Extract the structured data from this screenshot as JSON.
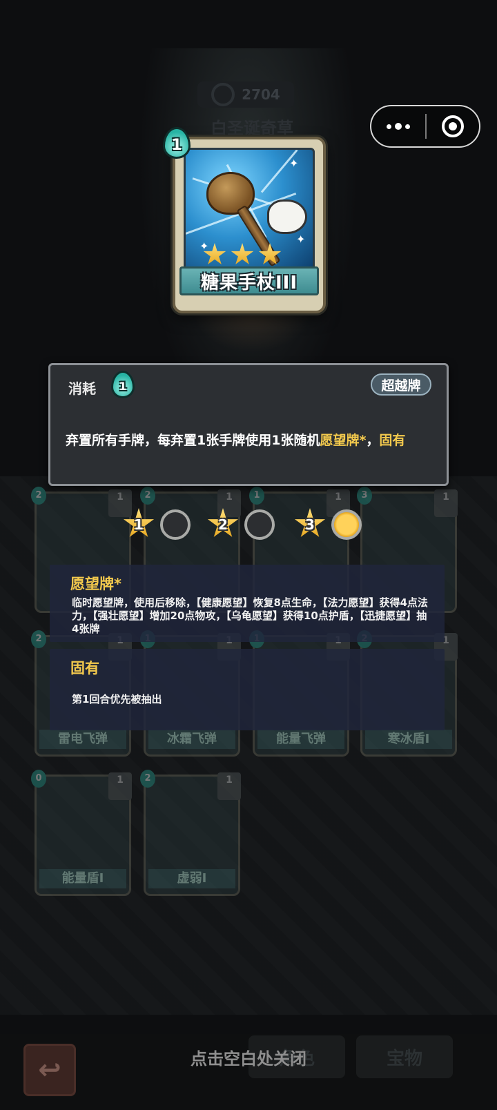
{
  "background": {
    "coin_value": "2704",
    "scene_title": "白圣诞奇草"
  },
  "capsule": {
    "more_icon": "more-dots-icon",
    "close_icon": "target-circle-icon"
  },
  "featured_card": {
    "cost": "1",
    "name": "糖果手杖III",
    "stars": 3
  },
  "info_panel": {
    "cost_label": "消耗",
    "cost_value": "1",
    "badge": "超越牌",
    "description_prefix": "弃置所有手牌，每弃置1张手牌使用1张随机",
    "description_keyword_1": "愿望牌*",
    "description_sep": "，",
    "description_keyword_2": "固有"
  },
  "tier_selector": {
    "tiers": [
      "1",
      "2",
      "3"
    ],
    "selected": "3"
  },
  "tooltips": [
    {
      "title": "愿望牌*",
      "body": "临时愿望牌，使用后移除，【健康愿望】恢复8点生命，【法力愿望】获得4点法力，【强壮愿望】增加20点物攻，【乌龟愿望】获得10点护盾，【迅捷愿望】抽4张牌"
    },
    {
      "title": "固有",
      "body": "第1回合优先被抽出"
    }
  ],
  "deck_cards": [
    {
      "cost": "2",
      "count": "1",
      "name": ""
    },
    {
      "cost": "2",
      "count": "1",
      "name": ""
    },
    {
      "cost": "1",
      "count": "1",
      "name": ""
    },
    {
      "cost": "3",
      "count": "1",
      "name": ""
    },
    {
      "cost": "2",
      "count": "1",
      "name": "雷电飞弹"
    },
    {
      "cost": "1",
      "count": "1",
      "name": "冰霜飞弹"
    },
    {
      "cost": "1",
      "count": "1",
      "name": "能量飞弹"
    },
    {
      "cost": "2",
      "count": "1",
      "name": "寒冰盾I"
    },
    {
      "cost": "0",
      "count": "1",
      "name": "能量盾I"
    },
    {
      "cost": "2",
      "count": "1",
      "name": "虚弱I"
    }
  ],
  "bottom": {
    "close_hint": "点击空白处关闭",
    "tab_role": "角色",
    "tab_treasure": "宝物",
    "back_icon": "back-arrow-icon"
  }
}
